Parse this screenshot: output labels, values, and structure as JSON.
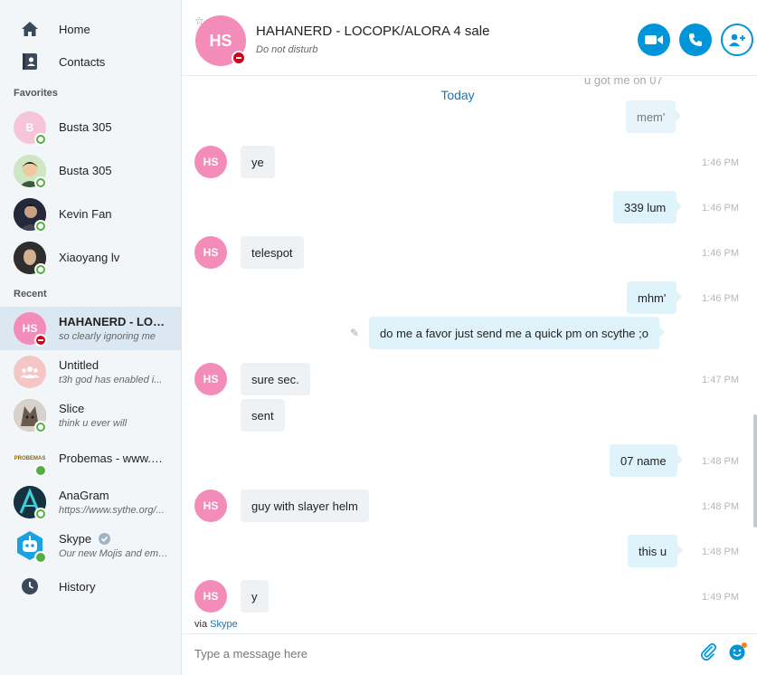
{
  "sidebar": {
    "nav": {
      "home": "Home",
      "contacts": "Contacts",
      "history": "History"
    },
    "favorites_label": "Favorites",
    "recent_label": "Recent",
    "favorites": [
      {
        "name": "Busta 305",
        "initials": "B",
        "status": "online"
      },
      {
        "name": "Busta 305",
        "initials": "",
        "status": "online"
      },
      {
        "name": "Kevin Fan",
        "initials": "",
        "status": "online"
      },
      {
        "name": "Xiaoyang lv",
        "initials": "",
        "status": "online"
      }
    ],
    "recent": [
      {
        "name": "HAHANERD - LOCOPK/ALORA 4 sale",
        "sub": "so clearly ignoring me",
        "initials": "HS",
        "status": "dnd"
      },
      {
        "name": "Untitled",
        "sub": "t3h god has enabled i...",
        "initials": "",
        "status": "none"
      },
      {
        "name": "Slice",
        "sub": "think u ever will",
        "initials": "",
        "status": "online"
      },
      {
        "name": "Probemas - www.probemas.com",
        "sub": "",
        "initials": "PROBEMAS",
        "status": "online-fill"
      },
      {
        "name": "AnaGram",
        "sub": "https://www.sythe.org/...",
        "initials": "",
        "status": "online"
      },
      {
        "name": "Skype",
        "sub": "Our new Mojis and emoticons",
        "initials": "",
        "status": "online-fill"
      }
    ]
  },
  "header": {
    "initials": "HS",
    "title": "HAHANERD - LOCOPK/ALORA 4 sale",
    "subtitle": "Do not disturb"
  },
  "chat": {
    "day_label": "Today",
    "faded_top_text": "u got me on 07",
    "faded_top_mhm": "mem'",
    "messages": [
      {
        "dir": "in",
        "text": "ye",
        "time": "1:46 PM"
      },
      {
        "dir": "out",
        "text": "339 lum",
        "time": "1:46 PM"
      },
      {
        "dir": "in",
        "text": "telespot",
        "time": "1:46 PM"
      },
      {
        "dir": "out",
        "text": "mhm'",
        "time": "1:46 PM"
      },
      {
        "dir": "out",
        "text": "do me a favor just send me a quick pm on scythe ;o",
        "time": ""
      },
      {
        "dir": "in",
        "text": "sure sec.",
        "time": "1:47 PM"
      },
      {
        "dir": "in",
        "text": "sent",
        "time": ""
      },
      {
        "dir": "out",
        "text": "07 name",
        "time": "1:48 PM"
      },
      {
        "dir": "in",
        "text": "guy with slayer helm",
        "time": "1:48 PM"
      },
      {
        "dir": "out",
        "text": "this u",
        "time": "1:48 PM"
      },
      {
        "dir": "in",
        "text": "y",
        "time": "1:49 PM"
      }
    ],
    "avatar_initials": "HS"
  },
  "footer": {
    "via_prefix": "via",
    "via_link": "Skype",
    "placeholder": "Type a message here"
  },
  "colors": {
    "accent": "#0094d8",
    "avatar_pink": "#f48cb9",
    "dnd": "#d0021b",
    "online": "#52b043"
  }
}
